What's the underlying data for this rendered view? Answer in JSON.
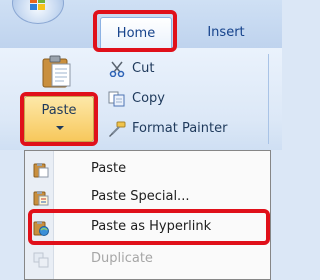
{
  "ribbon": {
    "tabs": [
      {
        "label": "Home",
        "active": true
      },
      {
        "label": "Insert",
        "active": false
      }
    ],
    "clipboard": {
      "paste_label": "Paste",
      "cut_label": "Cut",
      "copy_label": "Copy",
      "format_painter_label": "Format Painter"
    }
  },
  "paste_menu": {
    "items": [
      {
        "label": "Paste",
        "icon": "paste-icon",
        "enabled": true
      },
      {
        "label": "Paste Special...",
        "icon": "paste-special-icon",
        "enabled": true
      },
      {
        "label": "Paste as Hyperlink",
        "icon": "paste-hyperlink-icon",
        "enabled": true,
        "highlighted": true
      },
      {
        "label": "Duplicate",
        "icon": "duplicate-icon",
        "enabled": false
      }
    ]
  },
  "colors": {
    "highlight": "#e0101a",
    "ribbon_text": "#1e395b"
  }
}
